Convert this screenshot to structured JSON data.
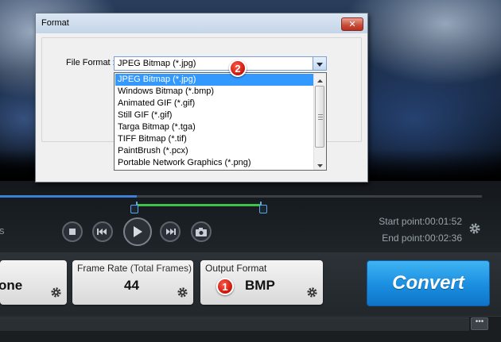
{
  "dialog": {
    "title": "Format",
    "close_symbol": "✕",
    "file_format_label": "File Format :",
    "selected_value": "JPEG Bitmap (*.jpg)",
    "options": [
      "JPEG Bitmap (*.jpg)",
      "Windows Bitmap (*.bmp)",
      "Animated GIF (*.gif)",
      "Still GIF (*.gif)",
      "Targa Bitmap (*.tga)",
      "TIFF Bitmap (*.tif)",
      "PaintBrush (*.pcx)",
      "Portable Network Graphics (*.png)"
    ],
    "highlighted_index": 0
  },
  "badges": {
    "step1": "1",
    "step2": "2",
    "color": "#d42010"
  },
  "player": {
    "left_fragment": "s",
    "start_label": "Start point:",
    "start_time": "00:01:52",
    "end_label": "End point:",
    "end_time": "00:02:36",
    "icons": [
      "stop-icon",
      "previous-icon",
      "play-icon",
      "next-icon",
      "snapshot-icon",
      "gear-icon"
    ]
  },
  "cards": {
    "partial_value": "one",
    "frame_rate_title": "Frame Rate",
    "frame_rate_subtitle": "(Total Frames)",
    "frame_rate_value": "44",
    "output_format_title": "Output Format",
    "output_format_value": "BMP"
  },
  "convert": {
    "label": "Convert",
    "color": "#1a8ee0"
  },
  "bottom": {
    "more_label": "•••"
  }
}
